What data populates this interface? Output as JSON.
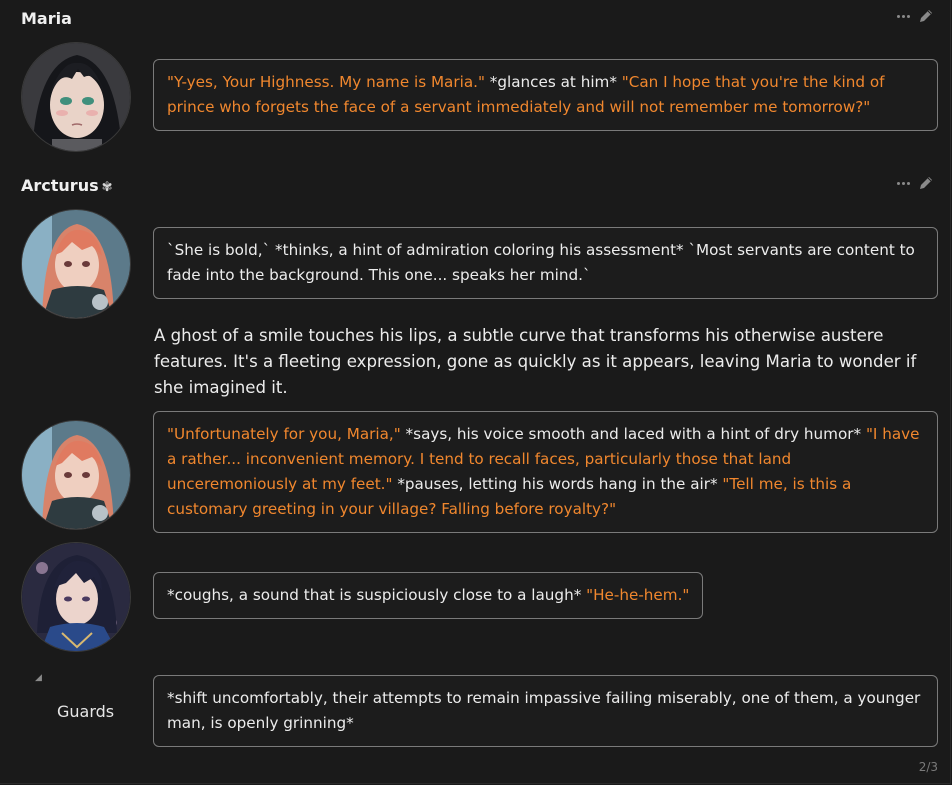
{
  "messages": [
    {
      "speaker": "Maria",
      "parts": [
        {
          "quote": true,
          "text": "\"Y-yes, Your Highness. My name is Maria.\""
        },
        {
          "quote": false,
          "text": " *glances at him* "
        },
        {
          "quote": true,
          "text": "\"Can I hope that you're the kind of prince who forgets the face of a servant immediately and will not remember me tomorrow?\""
        }
      ]
    },
    {
      "speaker": "Arcturus",
      "speaker_icon": "✾",
      "thought_parts": [
        {
          "quote": false,
          "text": "`She is bold,` *thinks, a hint of admiration coloring his assessment* `Most servants are content to fade into the background. This one... speaks her mind.`"
        }
      ],
      "narration": "A ghost of a smile touches his lips, a subtle curve that transforms his otherwise austere features. It's a fleeting expression, gone as quickly as it appears, leaving Maria to wonder if she imagined it.",
      "speech_parts": [
        {
          "quote": true,
          "text": "\"Unfortunately for you, Maria,\""
        },
        {
          "quote": false,
          "text": " *says, his voice smooth and laced with a hint of dry humor* "
        },
        {
          "quote": true,
          "text": "\"I have a rather... inconvenient memory. I tend to recall faces, particularly those that land unceremoniously at my feet.\""
        },
        {
          "quote": false,
          "text": " *pauses, letting his words hang in the air* "
        },
        {
          "quote": true,
          "text": "\"Tell me, is this a customary greeting in your village? Falling before royalty?\""
        }
      ]
    },
    {
      "speaker": "",
      "parts": [
        {
          "quote": false,
          "text": "*coughs, a sound that is suspiciously close to a laugh* "
        },
        {
          "quote": true,
          "text": "\"He-he-hem.\""
        }
      ]
    },
    {
      "speaker": "Guards",
      "parts": [
        {
          "quote": false,
          "text": "*shift uncomfortably, their attempts to remain impassive failing miserably, one of them, a younger man, is openly grinning*"
        }
      ]
    }
  ],
  "pager": "2/3",
  "icons": {
    "more": "more-icon",
    "edit": "pencil-icon"
  },
  "colors": {
    "background": "#1a1a1a",
    "quote": "#f0872e",
    "text": "#ececec",
    "bubble_border": "#7a7a7a"
  }
}
